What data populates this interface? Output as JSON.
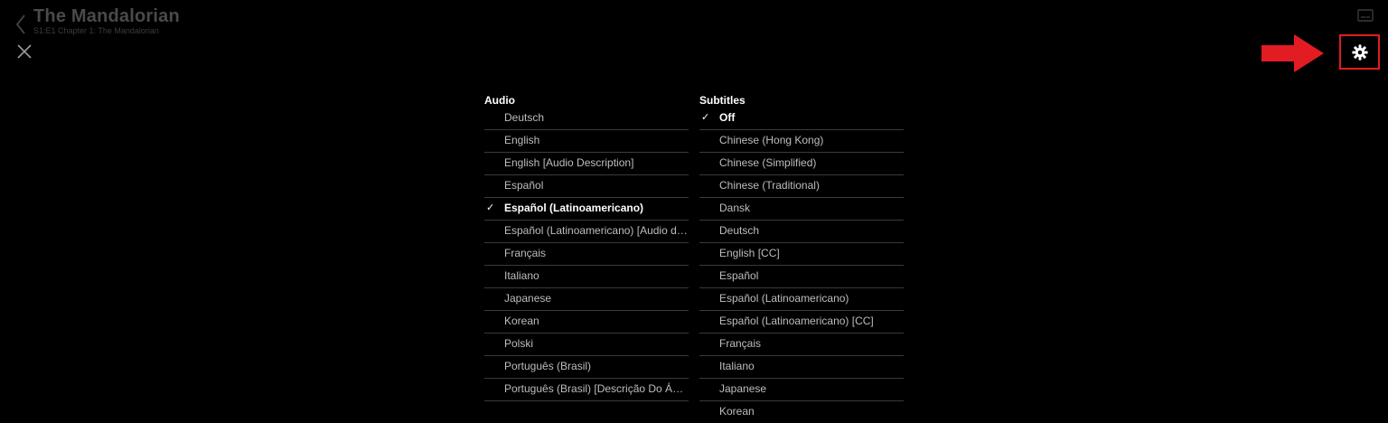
{
  "header": {
    "show_title": "The Mandalorian",
    "episode_title": "S1:E1 Chapter 1: The Mandalorian"
  },
  "audio": {
    "heading": "Audio",
    "options": [
      {
        "label": "Deutsch",
        "selected": false
      },
      {
        "label": "English",
        "selected": false
      },
      {
        "label": "English [Audio Description]",
        "selected": false
      },
      {
        "label": "Español",
        "selected": false
      },
      {
        "label": "Español (Latinoamericano)",
        "selected": true
      },
      {
        "label": "Español (Latinoamericano) [Audio de…",
        "selected": false
      },
      {
        "label": "Français",
        "selected": false
      },
      {
        "label": "Italiano",
        "selected": false
      },
      {
        "label": "Japanese",
        "selected": false
      },
      {
        "label": "Korean",
        "selected": false
      },
      {
        "label": "Polski",
        "selected": false
      },
      {
        "label": "Português (Brasil)",
        "selected": false
      },
      {
        "label": "Português (Brasil) [Descrição Do Áudio]",
        "selected": false
      }
    ]
  },
  "subtitles": {
    "heading": "Subtitles",
    "options": [
      {
        "label": "Off",
        "selected": true
      },
      {
        "label": "Chinese (Hong Kong)",
        "selected": false
      },
      {
        "label": "Chinese (Simplified)",
        "selected": false
      },
      {
        "label": "Chinese (Traditional)",
        "selected": false
      },
      {
        "label": "Dansk",
        "selected": false
      },
      {
        "label": "Deutsch",
        "selected": false
      },
      {
        "label": "English [CC]",
        "selected": false
      },
      {
        "label": "Español",
        "selected": false
      },
      {
        "label": "Español (Latinoamericano)",
        "selected": false
      },
      {
        "label": "Español (Latinoamericano) [CC]",
        "selected": false
      },
      {
        "label": "Français",
        "selected": false
      },
      {
        "label": "Italiano",
        "selected": false
      },
      {
        "label": "Japanese",
        "selected": false
      },
      {
        "label": "Korean",
        "selected": false
      }
    ]
  },
  "icons": {
    "back": "chevron-left-icon",
    "close": "close-icon",
    "captions": "captions-icon",
    "settings": "gear-icon",
    "annotation": "red-arrow-icon",
    "check": "checkmark-icon"
  },
  "colors": {
    "background": "#000000",
    "annotation_red": "#e31b23",
    "selected_text": "#ffffff",
    "option_text": "#bdbdbd",
    "divider": "#3a3a3a"
  }
}
